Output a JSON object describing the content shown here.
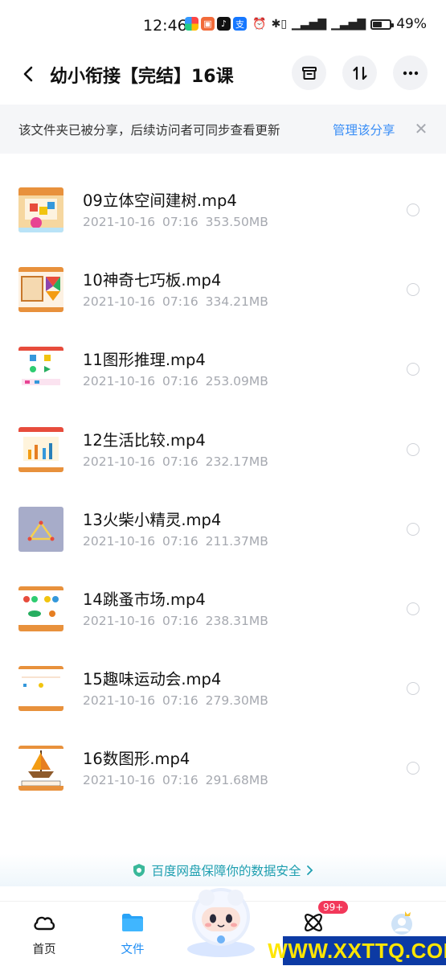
{
  "status_bar": {
    "time": "12:46",
    "battery": "49%",
    "battery_level": 0.49
  },
  "header": {
    "title": "幼小衔接【完结】16课"
  },
  "share_banner": {
    "text": "该文件夹已被分享，后续访问者可同步查看更新",
    "action": "管理该分享"
  },
  "files": [
    {
      "name": "09立体空间建树.mp4",
      "date": "2021-10-16  07:16",
      "size": "353.50MB"
    },
    {
      "name": "10神奇七巧板.mp4",
      "date": "2021-10-16  07:16",
      "size": "334.21MB"
    },
    {
      "name": "11图形推理.mp4",
      "date": "2021-10-16  07:16",
      "size": "253.09MB"
    },
    {
      "name": "12生活比较.mp4",
      "date": "2021-10-16  07:16",
      "size": "232.17MB"
    },
    {
      "name": "13火柴小精灵.mp4",
      "date": "2021-10-16  07:16",
      "size": "211.37MB"
    },
    {
      "name": "14跳蚤市场.mp4",
      "date": "2021-10-16  07:16",
      "size": "238.31MB"
    },
    {
      "name": "15趣味运动会.mp4",
      "date": "2021-10-16  07:16",
      "size": "279.30MB"
    },
    {
      "name": "16数图形.mp4",
      "date": "2021-10-16  07:16",
      "size": "291.68MB"
    }
  ],
  "security_note": "百度网盘保障你的数据安全",
  "tabs": {
    "home": "首页",
    "files": "文件"
  },
  "badge": "99+",
  "watermark": "WWW.XXTTQ.COM",
  "colors": {
    "accent": "#1e8ef5",
    "link": "#3a8ef6",
    "meta_text": "#a6a9b0",
    "badge": "#f2385a"
  }
}
